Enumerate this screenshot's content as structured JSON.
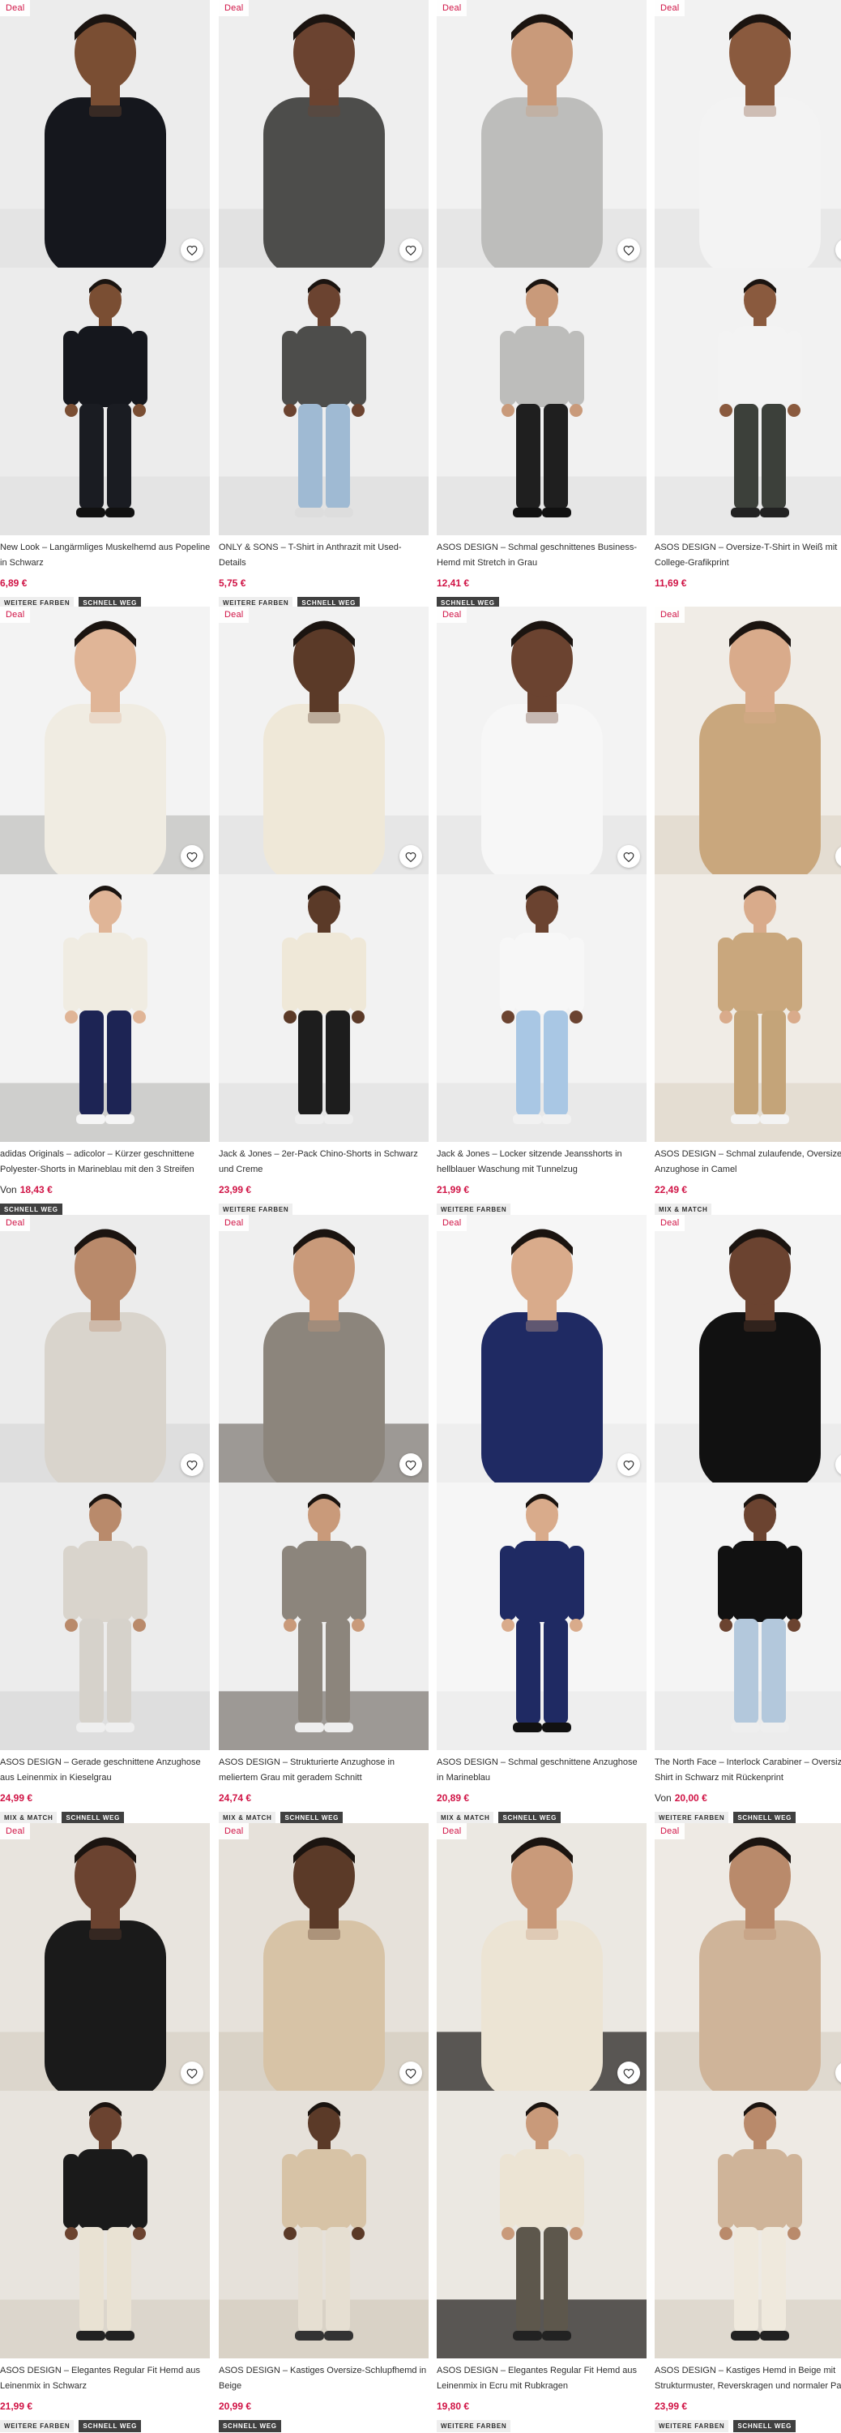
{
  "deal_label": "Deal",
  "colors": {
    "accent": "#d01345",
    "text": "#2d2d2d",
    "badge_dark": "#404040",
    "badge_light": "#eeeeee"
  },
  "products": [
    {
      "deal": true,
      "title1": "New Look – Langärmliges Muskelhemd aus Popeline",
      "title2": "in Schwarz",
      "price_prefix": "",
      "price": "6,89 €",
      "badges": [
        "WEITERE FARBEN",
        "SCHNELL WEG"
      ]
    },
    {
      "deal": true,
      "title1": "ONLY & SONS – T-Shirt in Anthrazit mit Used-",
      "title2": "Details",
      "price_prefix": "",
      "price": "5,75 €",
      "badges": [
        "WEITERE FARBEN",
        "SCHNELL WEG"
      ]
    },
    {
      "deal": true,
      "title1": "ASOS DESIGN – Schmal geschnittenes Business-",
      "title2": "Hemd mit Stretch in Grau",
      "price_prefix": "",
      "price": "12,41 €",
      "badges": [
        "SCHNELL WEG"
      ]
    },
    {
      "deal": true,
      "title1": "ASOS DESIGN – Oversize-T-Shirt in Weiß mit",
      "title2": "College-Grafikprint",
      "price_prefix": "",
      "price": "11,69 €",
      "badges": []
    },
    {
      "deal": true,
      "title1": "adidas Originals – adicolor – Kürzer geschnittene",
      "title2": "Polyester-Shorts in Marineblau mit den 3 Streifen",
      "price_prefix": "Von",
      "price": "18,43 €",
      "badges": [
        "SCHNELL WEG"
      ]
    },
    {
      "deal": true,
      "title1": "Jack & Jones – 2er-Pack Chino-Shorts in Schwarz",
      "title2": "und Creme",
      "price_prefix": "",
      "price": "23,99 €",
      "badges": [
        "WEITERE FARBEN"
      ]
    },
    {
      "deal": true,
      "title1": "Jack & Jones – Locker sitzende Jeansshorts in",
      "title2": "hellblauer Waschung mit Tunnelzug",
      "price_prefix": "",
      "price": "21,99 €",
      "badges": [
        "WEITERE FARBEN"
      ]
    },
    {
      "deal": true,
      "title1": "ASOS DESIGN – Schmal zulaufende, Oversize-",
      "title2": "Anzughose in Camel",
      "price_prefix": "",
      "price": "22,49 €",
      "badges": [
        "MIX & MATCH"
      ]
    },
    {
      "deal": true,
      "title1": "ASOS DESIGN – Gerade geschnittene Anzughose",
      "title2": "aus Leinenmix in Kieselgrau",
      "price_prefix": "",
      "price": "24,99 €",
      "badges": [
        "MIX & MATCH",
        "SCHNELL WEG"
      ]
    },
    {
      "deal": true,
      "title1": "ASOS DESIGN – Strukturierte Anzughose in",
      "title2": "meliertem Grau mit geradem Schnitt",
      "price_prefix": "",
      "price": "24,74 €",
      "badges": [
        "MIX & MATCH",
        "SCHNELL WEG"
      ]
    },
    {
      "deal": true,
      "title1": "ASOS DESIGN – Schmal geschnittene Anzughose",
      "title2": "in Marineblau",
      "price_prefix": "",
      "price": "20,89 €",
      "badges": [
        "MIX & MATCH",
        "SCHNELL WEG"
      ]
    },
    {
      "deal": true,
      "title1": "The North Face – Interlock Carabiner – Oversize-T-",
      "title2": "Shirt in Schwarz mit Rückenprint",
      "price_prefix": "Von",
      "price": "20,00 €",
      "badges": [
        "WEITERE FARBEN",
        "SCHNELL WEG"
      ]
    },
    {
      "deal": true,
      "title1": "ASOS DESIGN – Elegantes Regular Fit Hemd aus",
      "title2": "Leinenmix in Schwarz",
      "price_prefix": "",
      "price": "21,99 €",
      "badges": [
        "WEITERE FARBEN",
        "SCHNELL WEG"
      ]
    },
    {
      "deal": true,
      "title1": "ASOS DESIGN – Kastiges Oversize-Schlupfhemd in",
      "title2": "Beige",
      "price_prefix": "",
      "price": "20,99 €",
      "badges": [
        "SCHNELL WEG"
      ]
    },
    {
      "deal": true,
      "title1": "ASOS DESIGN – Elegantes Regular Fit Hemd aus",
      "title2": "Leinenmix in Ecru mit Rubkragen",
      "price_prefix": "",
      "price": "19,80 €",
      "badges": [
        "WEITERE FARBEN"
      ]
    },
    {
      "deal": true,
      "title1": "ASOS DESIGN – Kastiges Hemd in Beige mit",
      "title2": "Strukturmuster, Reverskragen und normaler Pass",
      "price_prefix": "",
      "price": "23,99 €",
      "badges": [
        "WEITERE FARBEN",
        "SCHNELL WEG"
      ]
    }
  ]
}
